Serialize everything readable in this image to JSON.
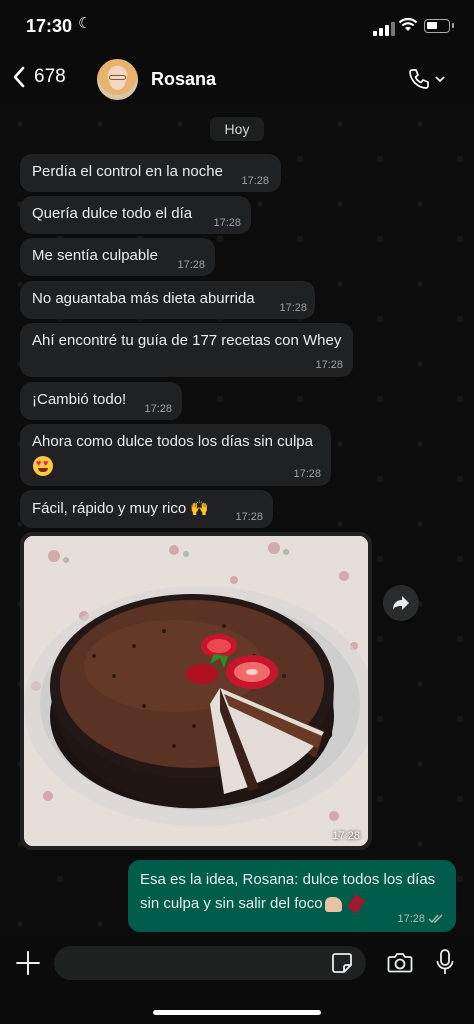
{
  "status_bar": {
    "time": "17:30"
  },
  "header": {
    "back_count": "678",
    "contact_name": "Rosana"
  },
  "chat": {
    "date_chip": "Hoy",
    "incoming": [
      {
        "text": "Perdía el control en la noche",
        "time": "17:28"
      },
      {
        "text": "Quería dulce todo el día",
        "time": "17:28"
      },
      {
        "text": "Me sentía culpable",
        "time": "17:28"
      },
      {
        "text": "No aguantaba más dieta aburrida",
        "time": "17:28"
      },
      {
        "text": "Ahí encontré tu guía de 177 recetas con Whey",
        "time": "17:28"
      },
      {
        "text": "¡Cambió todo!",
        "time": "17:28"
      },
      {
        "text": "Ahora como dulce todos los días sin culpa",
        "time": "17:28"
      },
      {
        "text": "Fácil, rápido y muy rico",
        "time": "17:28"
      }
    ],
    "image_message": {
      "time": "17:28",
      "alt": "chocolate tart with strawberries"
    },
    "outgoing": {
      "line1": "Esa es la idea, Rosana: dulce todos los días",
      "line2": "sin culpa y sin salir del foco",
      "time": "17:28"
    }
  },
  "icons": {
    "back": "chevron-left-icon",
    "call": "phone-icon",
    "forward": "forward-arrow-icon",
    "add": "plus-icon",
    "sticker": "sticker-icon",
    "camera": "camera-icon",
    "mic": "microphone-icon"
  },
  "colors": {
    "incoming_bubble": "#202122",
    "outgoing_bubble": "#005c4b",
    "background": "#0b0b0b"
  }
}
